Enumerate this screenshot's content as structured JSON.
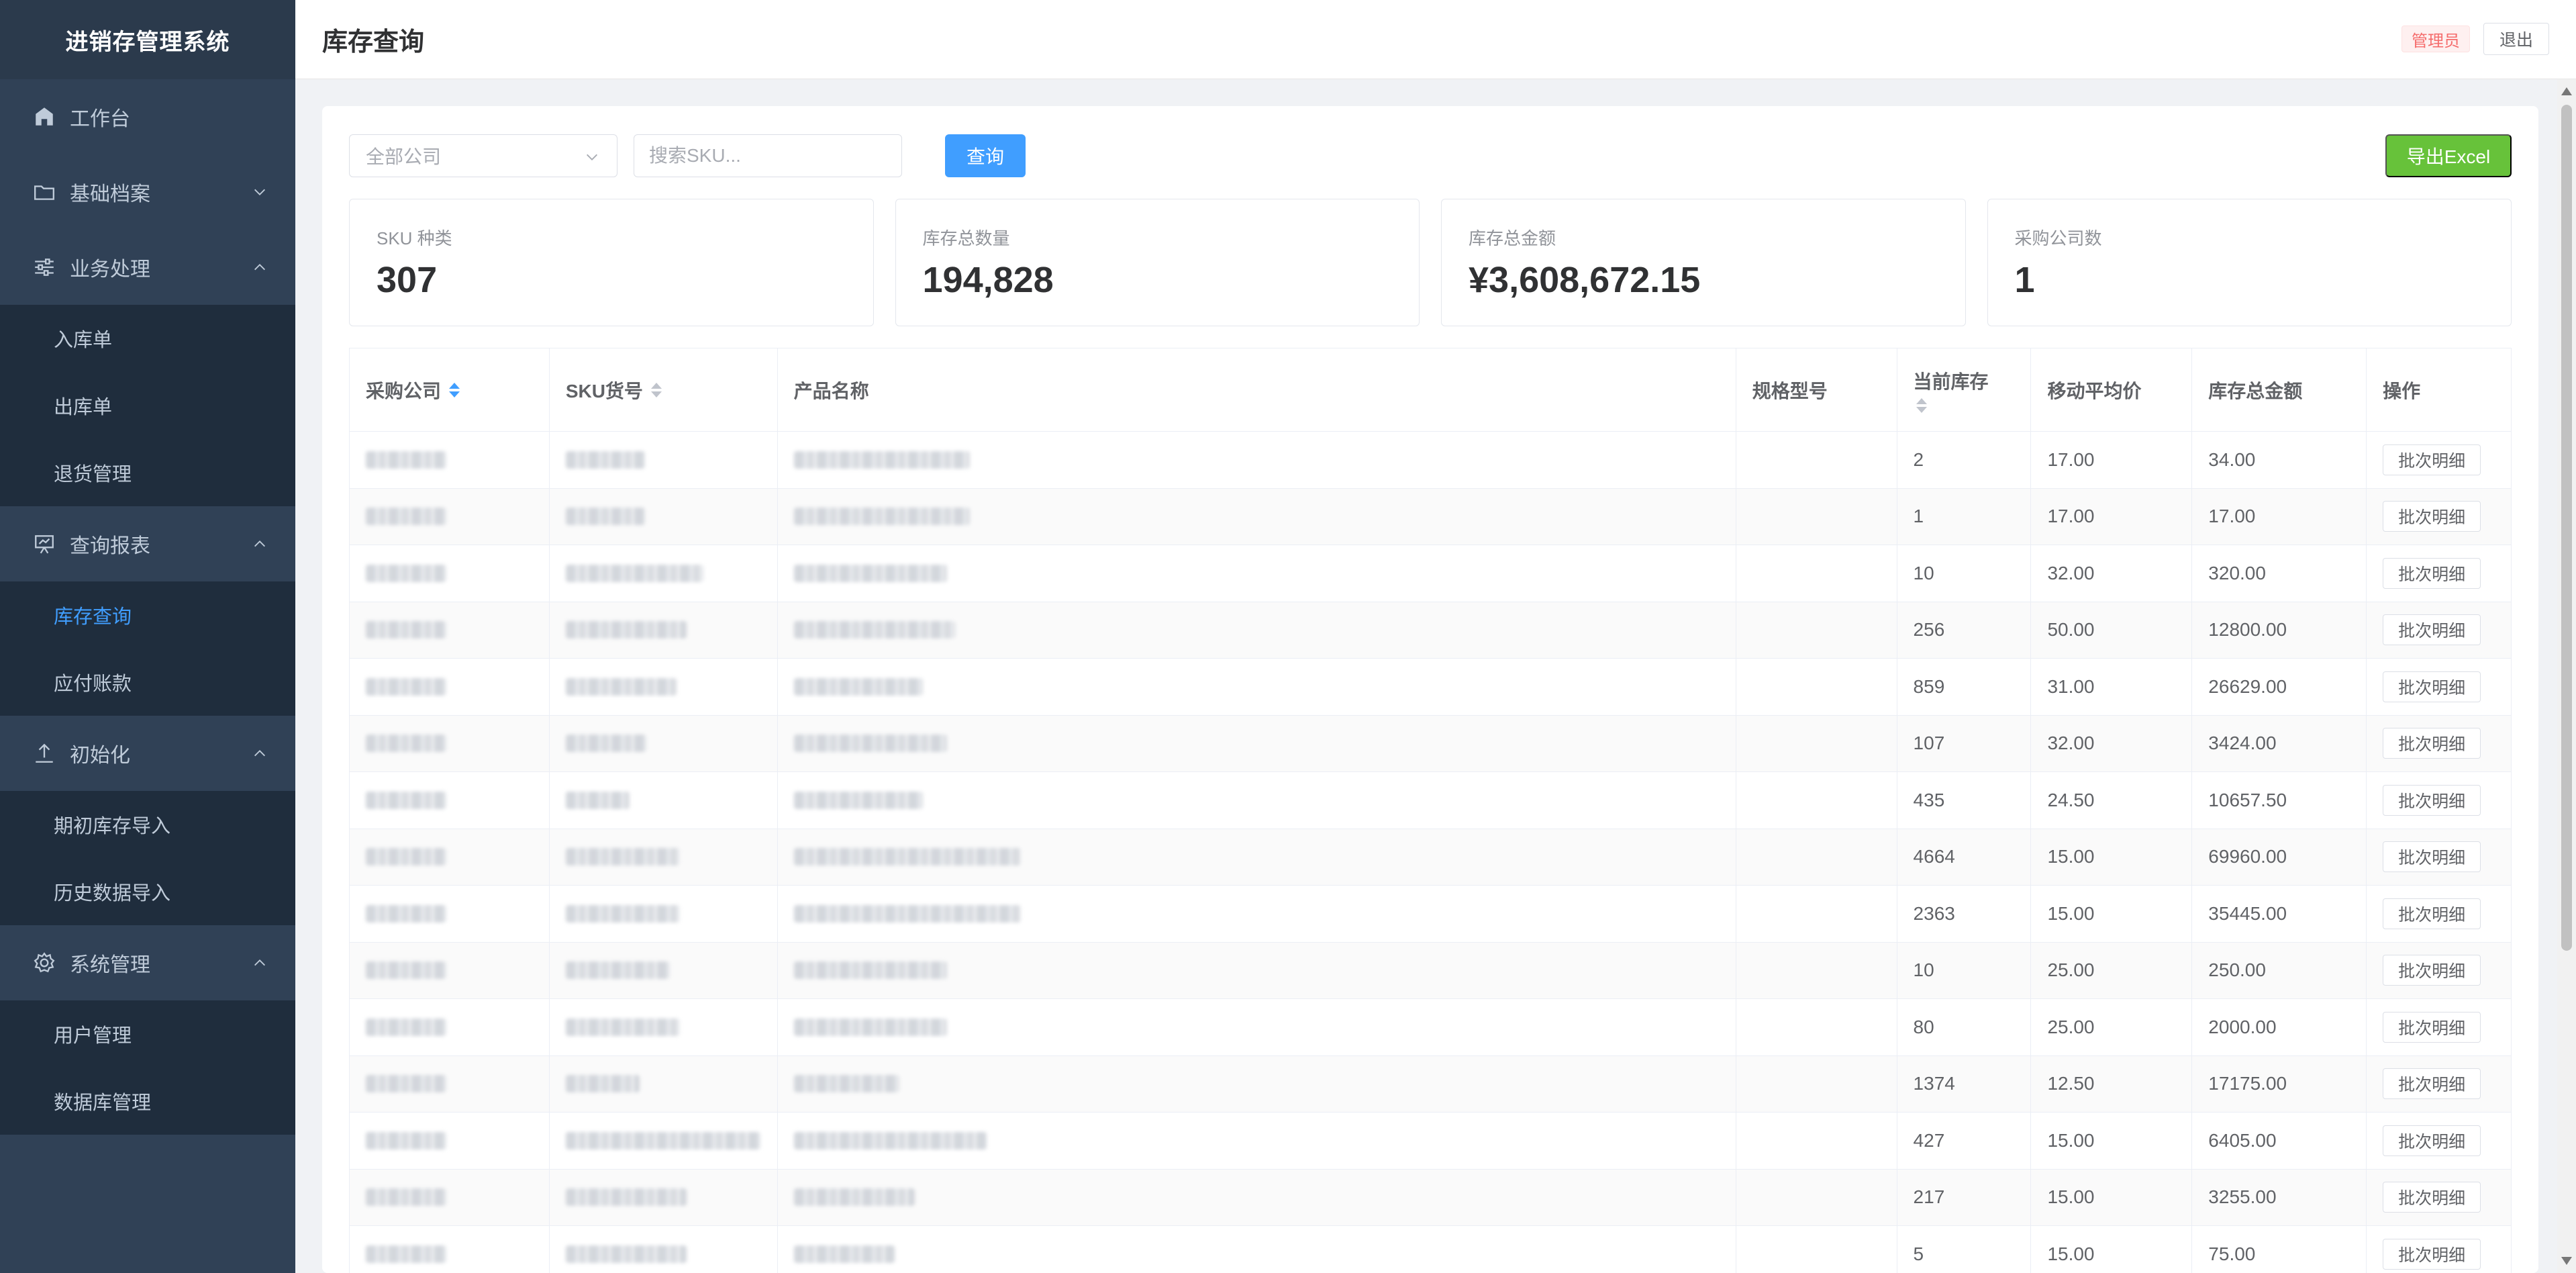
{
  "app": {
    "title": "进销存管理系统"
  },
  "sidebar": {
    "items": [
      {
        "type": "group",
        "label": "工作台",
        "icon": "home-icon",
        "expandable": false
      },
      {
        "type": "group",
        "label": "基础档案",
        "icon": "folder-icon",
        "expandable": true,
        "expanded": false
      },
      {
        "type": "group",
        "label": "业务处理",
        "icon": "sliders-icon",
        "expandable": true,
        "expanded": true
      },
      {
        "type": "sub",
        "label": "入库单"
      },
      {
        "type": "sub",
        "label": "出库单"
      },
      {
        "type": "sub",
        "label": "退货管理"
      },
      {
        "type": "group",
        "label": "查询报表",
        "icon": "presentation-icon",
        "expandable": true,
        "expanded": true
      },
      {
        "type": "sub",
        "label": "库存查询",
        "active": true
      },
      {
        "type": "sub",
        "label": "应付账款"
      },
      {
        "type": "group",
        "label": "初始化",
        "icon": "upload-icon",
        "expandable": true,
        "expanded": true
      },
      {
        "type": "sub",
        "label": "期初库存导入"
      },
      {
        "type": "sub",
        "label": "历史数据导入"
      },
      {
        "type": "group",
        "label": "系统管理",
        "icon": "gear-icon",
        "expandable": true,
        "expanded": true
      },
      {
        "type": "sub",
        "label": "用户管理"
      },
      {
        "type": "sub",
        "label": "数据库管理"
      }
    ]
  },
  "header": {
    "title": "库存查询",
    "role": "管理员",
    "logout": "退出"
  },
  "toolbar": {
    "company_select": "全部公司",
    "search_placeholder": "搜索SKU...",
    "query_label": "查询",
    "export_label": "导出Excel"
  },
  "stats": [
    {
      "label": "SKU 种类",
      "value": "307"
    },
    {
      "label": "库存总数量",
      "value": "194,828"
    },
    {
      "label": "库存总金额",
      "value": "¥3,608,672.15"
    },
    {
      "label": "采购公司数",
      "value": "1"
    }
  ],
  "table": {
    "columns": [
      "采购公司",
      "SKU货号",
      "产品名称",
      "规格型号",
      "当前库存",
      "移动平均价",
      "库存总金额",
      "操作"
    ],
    "action_label": "批次明细",
    "rows": [
      {
        "stock": "2",
        "price": "17.00",
        "amount": "34.00"
      },
      {
        "stock": "1",
        "price": "17.00",
        "amount": "17.00"
      },
      {
        "stock": "10",
        "price": "32.00",
        "amount": "320.00"
      },
      {
        "stock": "256",
        "price": "50.00",
        "amount": "12800.00"
      },
      {
        "stock": "859",
        "price": "31.00",
        "amount": "26629.00"
      },
      {
        "stock": "107",
        "price": "32.00",
        "amount": "3424.00"
      },
      {
        "stock": "435",
        "price": "24.50",
        "amount": "10657.50"
      },
      {
        "stock": "4664",
        "price": "15.00",
        "amount": "69960.00"
      },
      {
        "stock": "2363",
        "price": "15.00",
        "amount": "35445.00"
      },
      {
        "stock": "10",
        "price": "25.00",
        "amount": "250.00"
      },
      {
        "stock": "80",
        "price": "25.00",
        "amount": "2000.00"
      },
      {
        "stock": "1374",
        "price": "12.50",
        "amount": "17175.00"
      },
      {
        "stock": "427",
        "price": "15.00",
        "amount": "6405.00"
      },
      {
        "stock": "217",
        "price": "15.00",
        "amount": "3255.00"
      },
      {
        "stock": "5",
        "price": "15.00",
        "amount": "75.00"
      }
    ]
  },
  "colors": {
    "sidebar_bg": "#304156",
    "sidebar_active": "#409eff",
    "primary": "#409eff",
    "success": "#67c23a",
    "danger": "#f56c6c"
  }
}
